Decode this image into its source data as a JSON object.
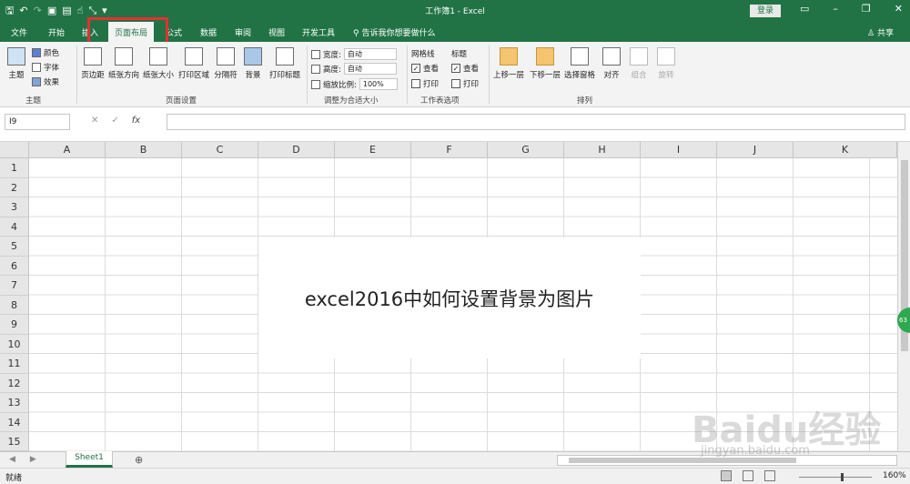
{
  "titlebar": {
    "title": "工作簿1 - Excel",
    "login": "登录",
    "qat_icons": [
      "save-icon",
      "undo-icon",
      "redo-icon",
      "copy-icon",
      "preview-icon",
      "touch-icon",
      "sort-icon",
      "customize-icon"
    ]
  },
  "tabs": [
    "文件",
    "开始",
    "插入",
    "页面布局",
    "公式",
    "数据",
    "审阅",
    "视图",
    "开发工具"
  ],
  "active_tab": "页面布局",
  "tellme": "告诉我你想要做什么",
  "share": "共享",
  "ribbon": {
    "themes": {
      "main": "主题",
      "colors": "颜色",
      "fonts": "字体",
      "effects": "效果",
      "group": "主题"
    },
    "page_setup": {
      "margins": "页边距",
      "orientation": "纸张方向",
      "size": "纸张大小",
      "print_area": "打印区域",
      "breaks": "分隔符",
      "background": "背景",
      "print_titles": "打印标题",
      "group": "页面设置"
    },
    "scale": {
      "width_label": "宽度:",
      "width_value": "自动",
      "height_label": "高度:",
      "height_value": "自动",
      "scale_label": "缩放比例:",
      "scale_value": "100%",
      "group": "调整为合适大小"
    },
    "sheet_options": {
      "gridlines": "网格线",
      "headings": "标题",
      "view": "查看",
      "print": "打印",
      "group": "工作表选项"
    },
    "arrange": {
      "bring_forward": "上移一层",
      "send_backward": "下移一层",
      "selection_pane": "选择窗格",
      "align": "对齐",
      "group_btn": "组合",
      "rotate": "旋转",
      "group": "排列"
    }
  },
  "namebox": "I9",
  "columns": [
    "A",
    "B",
    "C",
    "D",
    "E",
    "F",
    "G",
    "H",
    "I",
    "J",
    "K"
  ],
  "rows": [
    "1",
    "2",
    "3",
    "4",
    "5",
    "6",
    "7",
    "8",
    "9",
    "10",
    "11",
    "12",
    "13",
    "14",
    "15"
  ],
  "overlay_text": "excel2016中如何设置背景为图片",
  "sheet_tab": "Sheet1",
  "status": "就绪",
  "zoom": "160%",
  "watermark": "Baidu经验",
  "watermark_url": "jingyan.baidu.com",
  "badge": "63"
}
